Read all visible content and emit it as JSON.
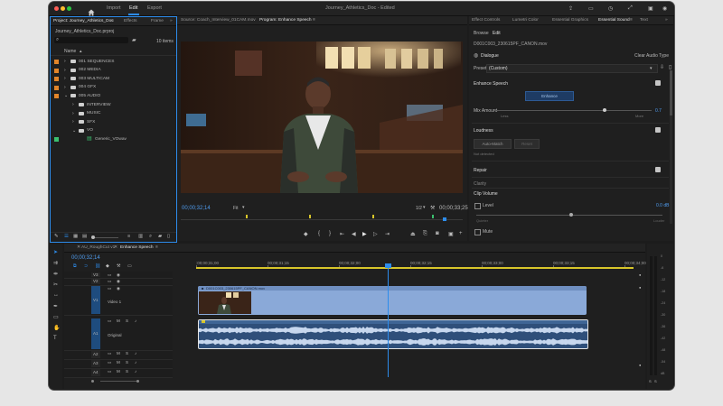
{
  "app": {
    "title": "Journey_Athletics_Doc - Edited",
    "nav": {
      "home": "home-icon",
      "import": "Import",
      "edit": "Edit",
      "export": "Export"
    }
  },
  "colors": {
    "accent_blue": "#2d8ceb",
    "clip_video": "#8aa9d8",
    "clip_audio": "#97b7e0",
    "playhead": "#2d8ceb",
    "orange_label": "#e2852a",
    "green_label": "#3bbf6f",
    "sync_yellow": "#d7c52a"
  },
  "project_panel": {
    "tabs": [
      "Project: Journey_Athletics_Doc",
      "Effects",
      "Frame"
    ],
    "file_name": "Journey_Athletics_Doc.prproj",
    "item_count": "10 items",
    "column_name": "Name",
    "items": [
      {
        "label": "001 SEQUENCES",
        "indent": 0
      },
      {
        "label": "002 MEDIA",
        "indent": 0
      },
      {
        "label": "003 MULTICAM",
        "indent": 0
      },
      {
        "label": "004 GFX",
        "indent": 0
      },
      {
        "label": "005 AUDIO",
        "indent": 0
      },
      {
        "label": "INTERVIEW",
        "indent": 1
      },
      {
        "label": "MUSIC",
        "indent": 1
      },
      {
        "label": "SFX",
        "indent": 1
      },
      {
        "label": "VO",
        "indent": 1
      },
      {
        "label": "Generic_VOwav",
        "indent": 2
      }
    ]
  },
  "source_panel": {
    "tabs": [
      "Source: Coach_Interview_01CAM.mov",
      "Program: Enhance Speech"
    ],
    "current_timecode": "00;00;32;14",
    "fit": "Fit",
    "resolution": "1/2",
    "end_timecode": "00;00;33;25"
  },
  "essential_sound": {
    "tabs": [
      "Effect Controls",
      "Lumetri Color",
      "Essential Graphics",
      "Essential Sound",
      "Text"
    ],
    "subtabs": [
      "Browse",
      "Edit"
    ],
    "clip_name": "D001C003_230615PF_CANON.mov",
    "dialogue_label": "Dialogue",
    "clear_label": "Clear Audio Type",
    "preset_label": "Preset",
    "preset_value": "(Custom)",
    "enhance_header": "Enhance Speech",
    "enhance_button": "Enhance",
    "mix_amount_label": "Mix Amount",
    "mix_low": "Less",
    "mix_high": "More",
    "mix_value": "0.7",
    "loudness_header": "Loudness",
    "automatch_button": "Auto-Match",
    "reset_button": "Reset",
    "not_detected": "Not detected",
    "repair_header": "Repair",
    "clarity_header": "Clarity",
    "clip_volume_header": "Clip Volume",
    "level_label": "Level",
    "level_value": "0.0 dB",
    "quieter": "Quieter",
    "louder": "Louder",
    "mute_label": "Mute"
  },
  "timeline": {
    "tabs": [
      "AU_RoughCut v1",
      "Enhance Speech"
    ],
    "timecode": "00;00;32;14",
    "ruler": [
      ":00;00;31;00",
      "00;00;31;15",
      "00;00;32;00",
      "00;00;32;15",
      "00;00;33;00",
      "00;00;33;15",
      "00;00;34;00"
    ],
    "video_tracks": [
      "V3",
      "V2",
      "V1"
    ],
    "video1_name": "Video 1",
    "audio_tracks": [
      "A1",
      "A2",
      "A3",
      "A4"
    ],
    "audio1_name": "Original",
    "clip_name": "D001C003_230615PF_CANON.mov",
    "audio_fx": "fx",
    "track_letters": [
      "M",
      "S"
    ],
    "meter_scale": [
      "0",
      "-6",
      "-12",
      "-18",
      "-24",
      "-30",
      "-36",
      "-42",
      "-48",
      "-54",
      "dB"
    ]
  }
}
